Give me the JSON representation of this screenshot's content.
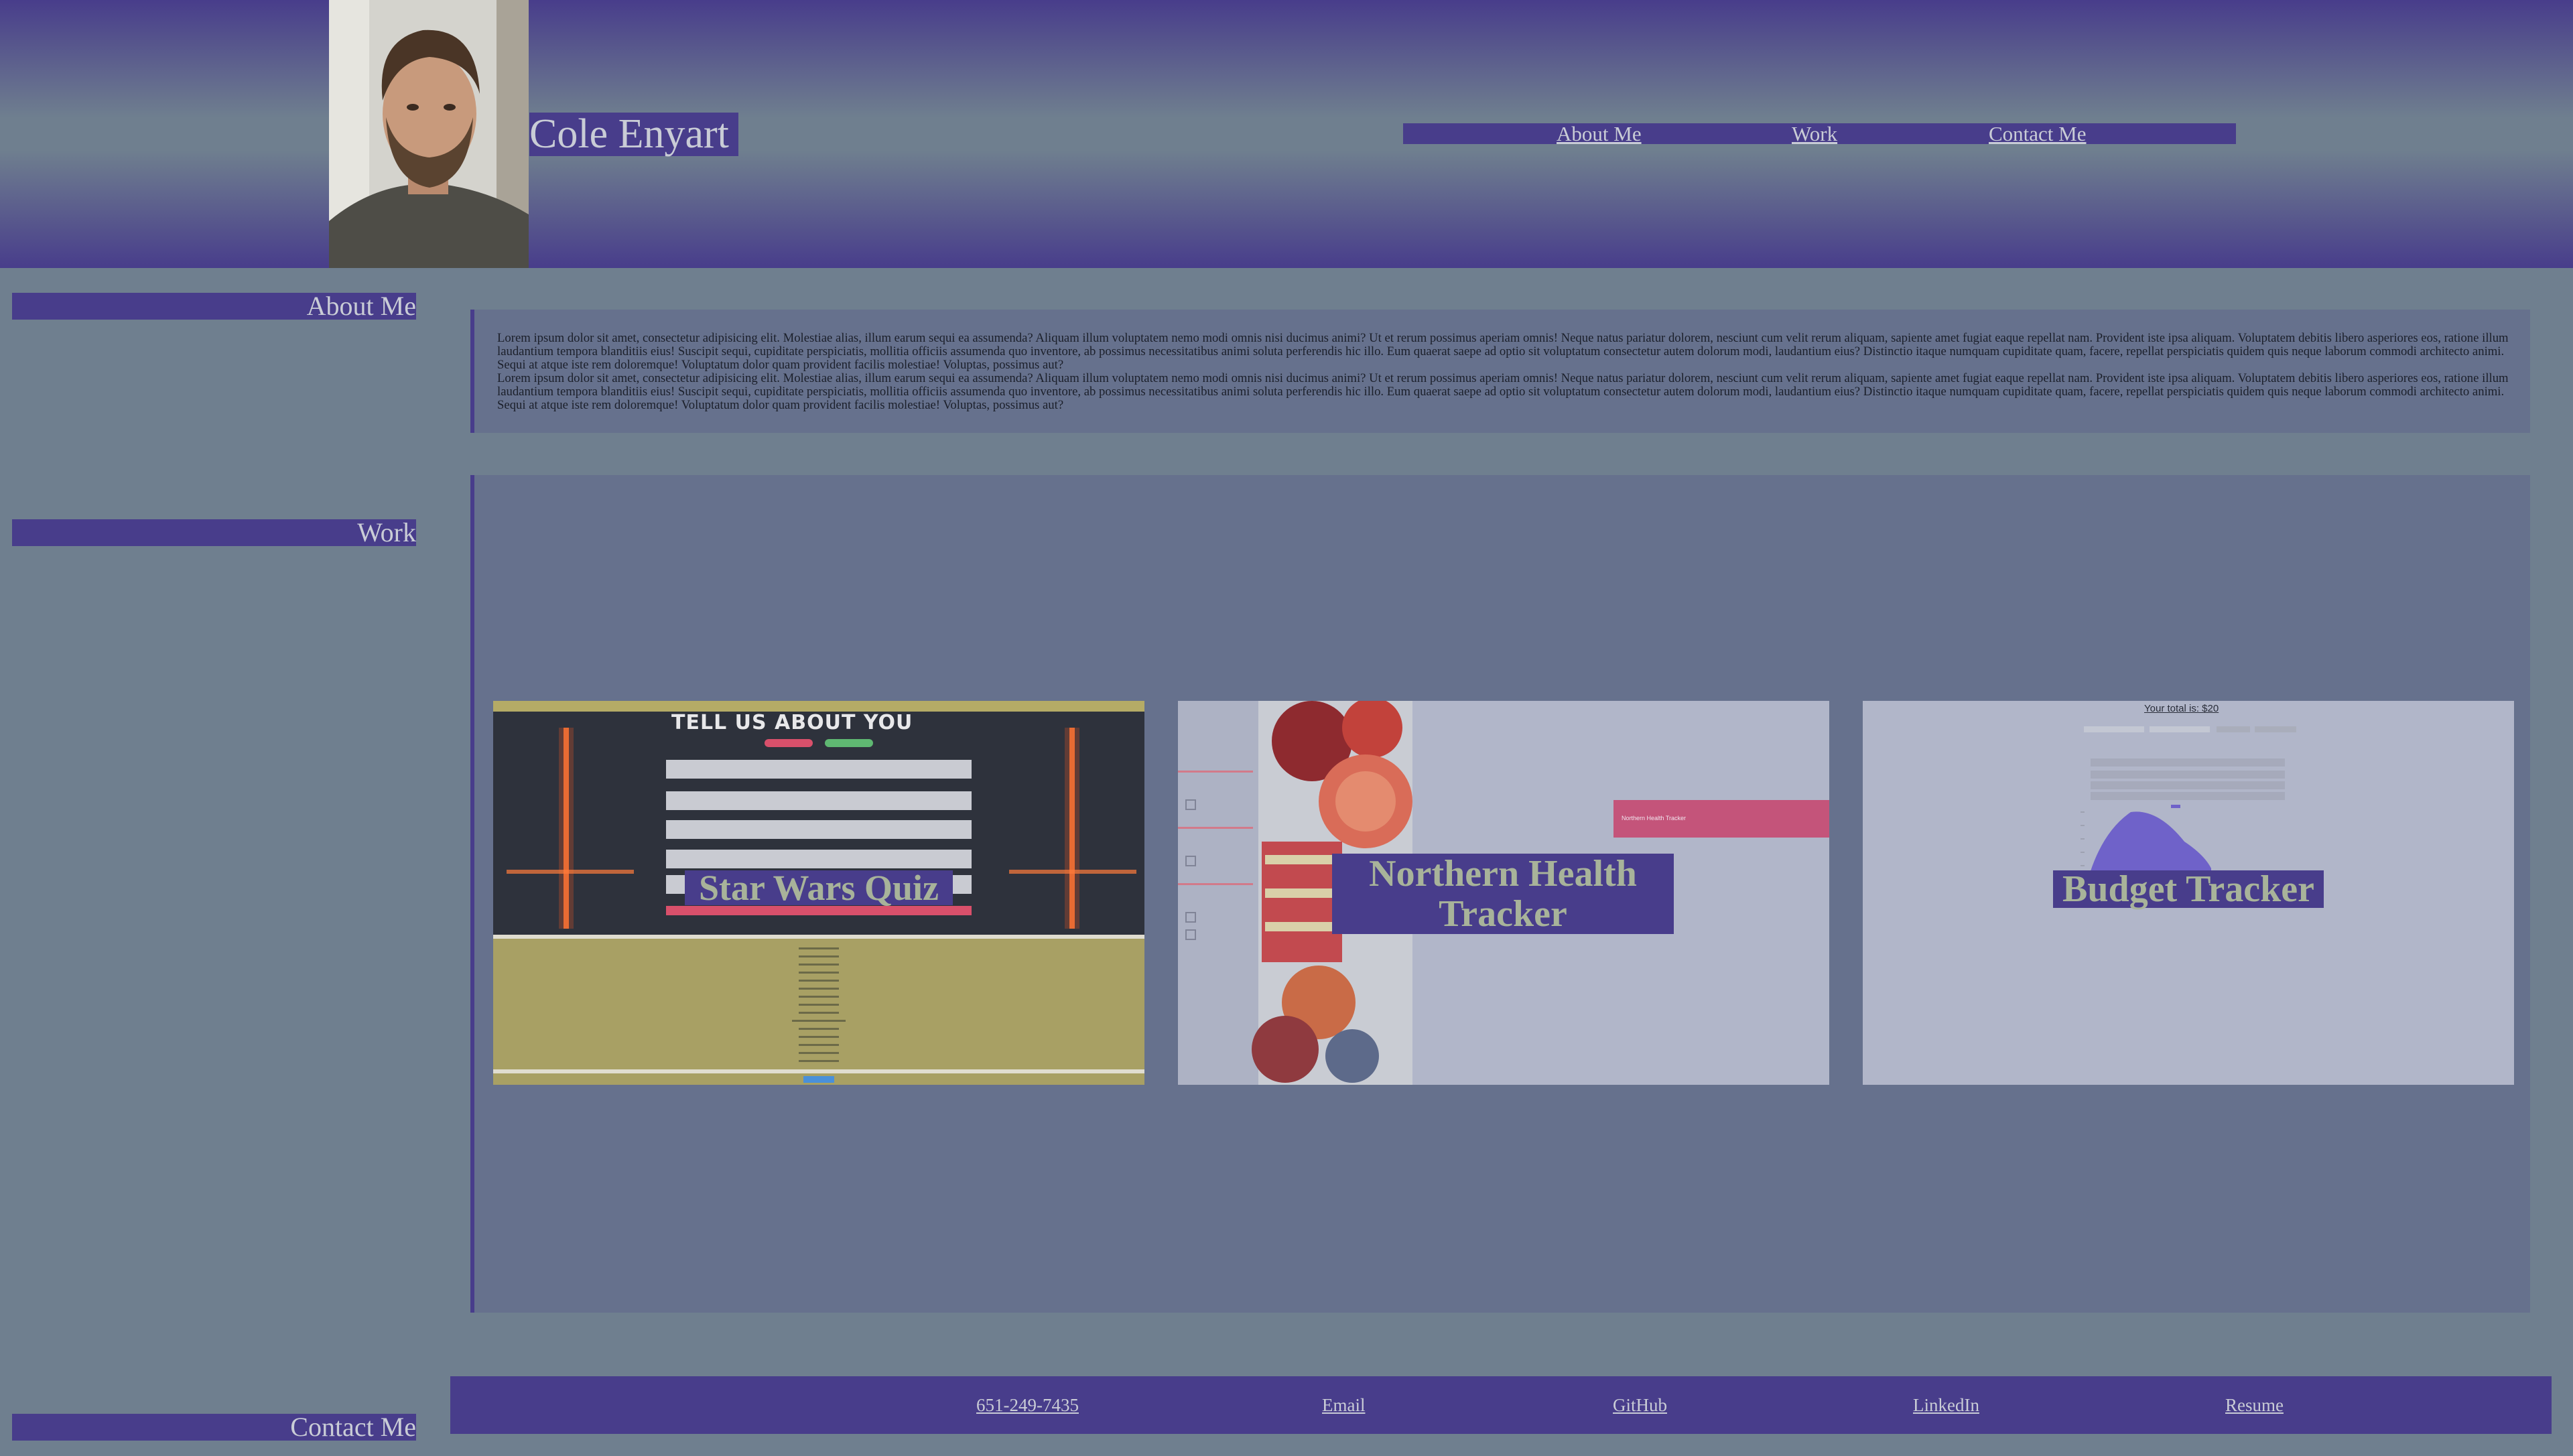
{
  "header": {
    "site_title": "Cole Enyart",
    "nav": [
      {
        "label": "About Me"
      },
      {
        "label": "Work"
      },
      {
        "label": "Contact Me"
      }
    ]
  },
  "sections": {
    "about_label": "About Me",
    "work_label": "Work",
    "contact_label": "Contact Me"
  },
  "about": {
    "paragraphs": [
      "Lorem ipsum dolor sit amet, consectetur adipisicing elit. Molestiae alias, illum earum sequi ea assumenda? Aliquam illum voluptatem nemo modi omnis nisi ducimus animi? Ut et rerum possimus aperiam omnis! Neque natus pariatur dolorem, nesciunt cum velit rerum aliquam, sapiente amet fugiat eaque repellat nam. Provident iste ipsa aliquam. Voluptatem debitis libero asperiores eos, ratione illum laudantium tempora blanditiis eius! Suscipit sequi, cupiditate perspiciatis, mollitia officiis assumenda quo inventore, ab possimus necessitatibus animi soluta perferendis hic illo. Eum quaerat saepe ad optio sit voluptatum consectetur autem dolorum modi, laudantium eius? Distinctio itaque numquam cupiditate quam, facere, repellat perspiciatis quidem quis neque laborum commodi architecto animi. Sequi at atque iste rem doloremque! Voluptatum dolor quam provident facilis molestiae! Voluptas, possimus aut?",
      "Lorem ipsum dolor sit amet, consectetur adipisicing elit. Molestiae alias, illum earum sequi ea assumenda? Aliquam illum voluptatem nemo modi omnis nisi ducimus animi? Ut et rerum possimus aperiam omnis! Neque natus pariatur dolorem, nesciunt cum velit rerum aliquam, sapiente amet fugiat eaque repellat nam. Provident iste ipsa aliquam. Voluptatem debitis libero asperiores eos, ratione illum laudantium tempora blanditiis eius! Suscipit sequi, cupiditate perspiciatis, mollitia officiis assumenda quo inventore, ab possimus necessitatibus animi soluta perferendis hic illo. Eum quaerat saepe ad optio sit voluptatum consectetur autem dolorum modi, laudantium eius? Distinctio itaque numquam cupiditate quam, facere, repellat perspiciatis quidem quis neque laborum commodi architecto animi. Sequi at atque iste rem doloremque! Voluptatum dolor quam provident facilis molestiae! Voluptas, possimus aut?"
    ]
  },
  "work": {
    "projects": [
      {
        "title": "Star Wars Quiz",
        "preview_heading": "TELL US ABOUT YOU"
      },
      {
        "title": "Northern Health Tracker",
        "preview_banner": "Northern Health Tracker"
      },
      {
        "title": "Budget Tracker",
        "preview_total": "Your total is: $20"
      }
    ]
  },
  "footer": {
    "links": [
      {
        "label": "651-249-7435"
      },
      {
        "label": "Email"
      },
      {
        "label": "GitHub"
      },
      {
        "label": "LinkedIn"
      },
      {
        "label": "Resume"
      }
    ]
  },
  "colors": {
    "primary": "#483d8b",
    "background": "#6f7f8f",
    "panel": "#66718d",
    "link": "#c9ccd6",
    "card_label_text": "#a8b39a"
  }
}
